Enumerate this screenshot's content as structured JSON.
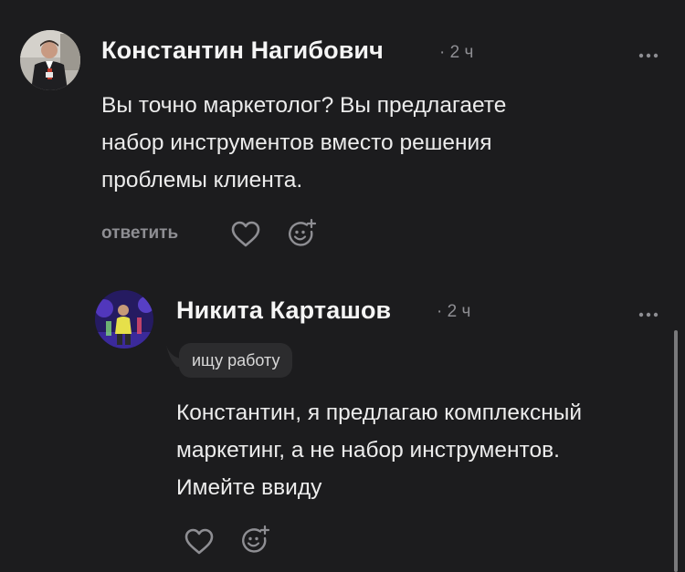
{
  "comments": [
    {
      "author": "Константин Нагибович",
      "separator": "·",
      "time": "2 ч",
      "more_icon": "ellipsis-icon",
      "lines": [
        "Вы точно маркетолог? Вы предлагаете",
        "набор инструментов вместо решения",
        "проблемы клиента."
      ],
      "reply_label": "ответить",
      "like_icon": "heart-icon",
      "react_icon": "add-reaction-icon"
    },
    {
      "author": "Никита Карташов",
      "separator": "·",
      "time": "2 ч",
      "more_icon": "ellipsis-icon",
      "badge": "ищу работу",
      "lines": [
        "Константин, я предлагаю комплексный",
        "маркетинг, а не набор инструментов.",
        "Имейте ввиду"
      ],
      "like_icon": "heart-icon",
      "react_icon": "add-reaction-icon"
    }
  ],
  "colors": {
    "background": "#1c1c1e",
    "text": "#ececec",
    "muted": "#8e8e93",
    "badge_bg": "#2c2c2e"
  }
}
